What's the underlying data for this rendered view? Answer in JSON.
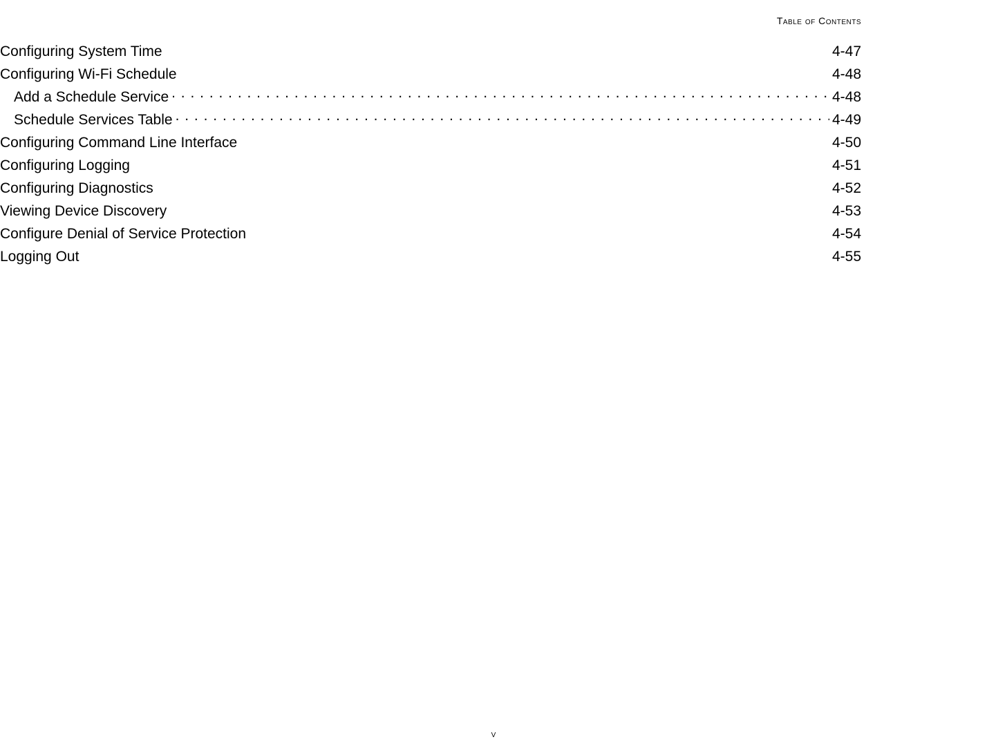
{
  "header": {
    "label": "Table of Contents"
  },
  "entries": [
    {
      "title": "Configuring System Time",
      "page": "4-47",
      "level": 0,
      "leader": "empty"
    },
    {
      "title": "Configuring Wi-Fi Schedule",
      "page": "4-48",
      "level": 0,
      "leader": "empty"
    },
    {
      "title": "Add a Schedule Service",
      "page": "4-48",
      "level": 1,
      "leader": "dotted"
    },
    {
      "title": "Schedule Services Table",
      "page": "4-49",
      "level": 1,
      "leader": "dotted"
    },
    {
      "title": "Configuring Command Line Interface",
      "page": "4-50",
      "level": 0,
      "leader": "empty"
    },
    {
      "title": "Configuring Logging",
      "page": "4-51",
      "level": 0,
      "leader": "empty"
    },
    {
      "title": "Configuring Diagnostics",
      "page": "4-52",
      "level": 0,
      "leader": "empty"
    },
    {
      "title": "Viewing Device Discovery",
      "page": "4-53",
      "level": 0,
      "leader": "empty"
    },
    {
      "title": "Configure Denial of Service Protection",
      "page": "4-54",
      "level": 0,
      "leader": "empty"
    },
    {
      "title": "Logging Out",
      "page": "4-55",
      "level": 0,
      "leader": "empty"
    }
  ],
  "footer": {
    "page_number": "v"
  }
}
